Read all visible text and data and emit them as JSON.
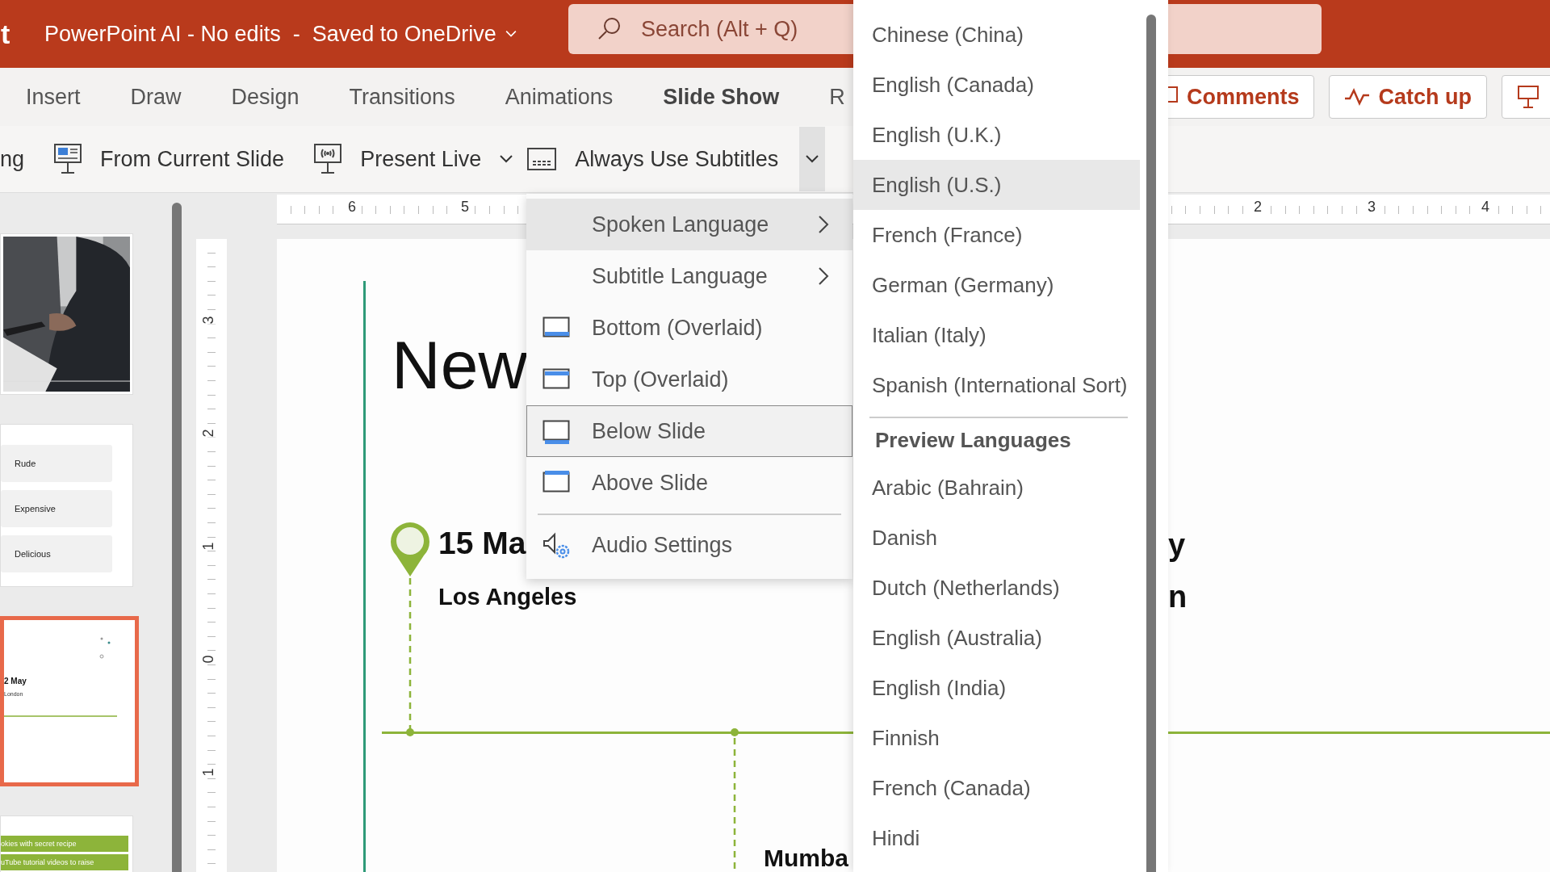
{
  "title_bar": {
    "app_fragment": "t",
    "document_title": "PowerPoint AI - No edits  -  Saved to OneDrive",
    "search": {
      "placeholder": "Search (Alt + Q)"
    }
  },
  "ribbon_tabs": [
    {
      "label": "Insert",
      "selected": false
    },
    {
      "label": "Draw",
      "selected": false
    },
    {
      "label": "Design",
      "selected": false
    },
    {
      "label": "Transitions",
      "selected": false
    },
    {
      "label": "Animations",
      "selected": false
    },
    {
      "label": "Slide Show",
      "selected": true
    },
    {
      "label": "R",
      "selected": false
    }
  ],
  "header_buttons": [
    {
      "label": "Comments",
      "kind": "comments"
    },
    {
      "label": "Catch up",
      "kind": "catch-up"
    },
    {
      "kind": "present"
    }
  ],
  "toolbar": [
    {
      "label": "ng",
      "kind": "fragment",
      "dropdown": false
    },
    {
      "label": "From Current Slide",
      "kind": "from-current",
      "dropdown": false
    },
    {
      "label": "Present Live",
      "kind": "present-live",
      "dropdown": true
    },
    {
      "label": "Always Use Subtitles",
      "kind": "subtitles",
      "dropdown": true
    }
  ],
  "ruler": {
    "left_labels": [
      "6",
      "5"
    ],
    "right_labels": [
      "2",
      "3",
      "4"
    ],
    "vertical_labels": [
      "3",
      "2",
      "1",
      "0",
      "1"
    ]
  },
  "thumbnails": [
    {
      "kind": "picture",
      "selected": false
    },
    {
      "kind": "list",
      "items": [
        "Rude",
        "Expensive",
        "Delicious"
      ],
      "selected": false
    },
    {
      "kind": "timeline",
      "date": "2 May",
      "place": "London",
      "selected": true
    },
    {
      "kind": "bars",
      "items": [
        "okies with secret recipe",
        "uTube tutorial videos to raise"
      ],
      "selected": false
    }
  ],
  "slide": {
    "title": "New",
    "event_date": "15 Ma",
    "event_place": "Los Angeles",
    "second_place": "Mumba",
    "right_fragments": [
      "y",
      "n"
    ]
  },
  "subtitles_menu": {
    "items": [
      {
        "label": "Spoken Language",
        "kind": "submenu",
        "expanded": true,
        "selected": false
      },
      {
        "label": "Subtitle Language",
        "kind": "submenu",
        "expanded": false,
        "selected": false
      },
      {
        "label": "Bottom (Overlaid)",
        "kind": "bottom",
        "selected": false
      },
      {
        "label": "Top (Overlaid)",
        "kind": "top",
        "selected": false
      },
      {
        "label": "Below Slide",
        "kind": "below",
        "selected": true
      },
      {
        "label": "Above Slide",
        "kind": "above",
        "selected": false
      }
    ],
    "settings_items": [
      {
        "label": "Audio Settings",
        "kind": "audio",
        "selected": false
      }
    ]
  },
  "language_menu": {
    "items": [
      {
        "label": "Chinese (China)",
        "hovered": false
      },
      {
        "label": "English (Canada)",
        "hovered": false
      },
      {
        "label": "English (U.K.)",
        "hovered": false
      },
      {
        "label": "English (U.S.)",
        "hovered": true
      },
      {
        "label": "French (France)",
        "hovered": false
      },
      {
        "label": "German (Germany)",
        "hovered": false
      },
      {
        "label": "Italian (Italy)",
        "hovered": false
      },
      {
        "label": "Spanish (International Sort)",
        "hovered": false
      }
    ],
    "preview_section": {
      "title": "Preview Languages",
      "items": [
        {
          "label": "Arabic (Bahrain)",
          "hovered": false
        },
        {
          "label": "Danish",
          "hovered": false
        },
        {
          "label": "Dutch (Netherlands)",
          "hovered": false
        },
        {
          "label": "English (Australia)",
          "hovered": false
        },
        {
          "label": "English (India)",
          "hovered": false
        },
        {
          "label": "Finnish",
          "hovered": false
        },
        {
          "label": "French (Canada)",
          "hovered": false
        },
        {
          "label": "Hindi",
          "hovered": false
        }
      ]
    }
  }
}
